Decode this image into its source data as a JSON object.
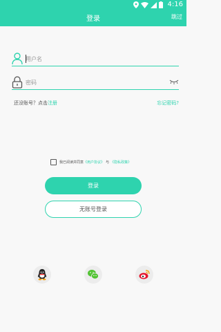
{
  "status_bar": {
    "time": "4:16"
  },
  "app_bar": {
    "title": "登录",
    "skip_label": "跳过"
  },
  "form": {
    "username_placeholder": "用户名",
    "password_placeholder": "密码"
  },
  "register": {
    "prompt": "还没账号？点击",
    "link": "注册"
  },
  "forgot_password": "忘记密码?",
  "agreement": {
    "text_before": "我已阅读并同意",
    "user_agreement": "《用户协议》",
    "connector": "与",
    "privacy_policy": "《隐私政策》",
    "checked": false
  },
  "buttons": {
    "login": "登录",
    "guest_login": "无账号登录"
  },
  "social_login": [
    "qq-icon",
    "wechat-icon",
    "weibo-icon"
  ],
  "colors": {
    "accent": "#2ed3ae",
    "background": "#f8f8f8"
  }
}
